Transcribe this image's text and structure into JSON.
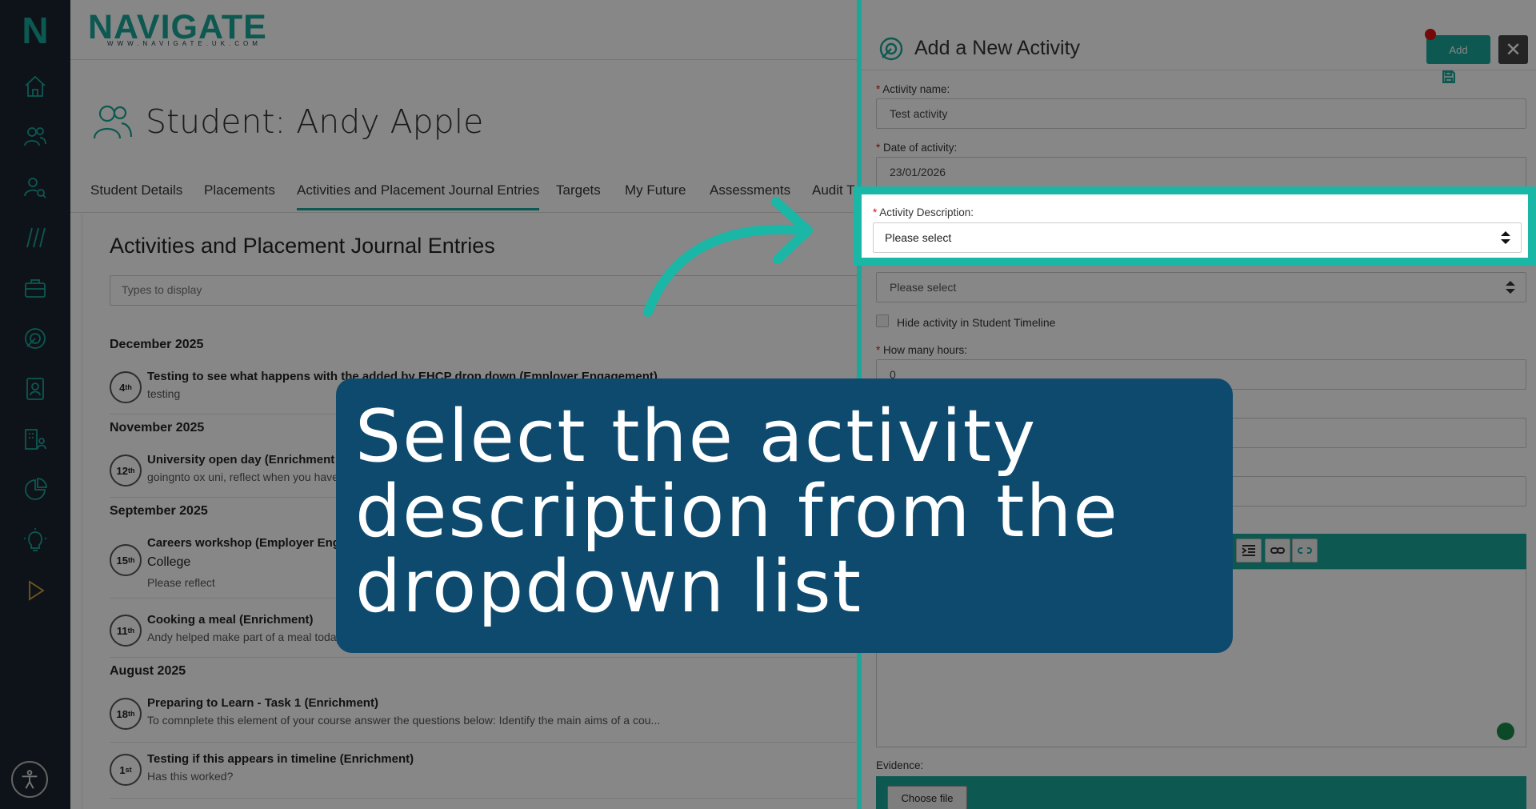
{
  "sidebar": {
    "logo": "N",
    "icons": [
      "home-icon",
      "users-icon",
      "user-search-icon",
      "slashes-icon",
      "briefcase-icon",
      "activity-icon",
      "contact-card-icon",
      "building-people-icon",
      "pie-chart-icon",
      "lightbulb-icon",
      "play-icon"
    ],
    "accessibility": "accessibility-icon"
  },
  "header": {
    "brand": "NAVIGATE",
    "brand_url": "WWW.NAVIGATE.UK.COM"
  },
  "student": {
    "title": "Student: Andy Apple"
  },
  "tabs": [
    "Student Details",
    "Placements",
    "Activities and Placement Journal Entries",
    "Targets",
    "My Future",
    "Assessments",
    "Audit T"
  ],
  "page": {
    "heading": "Activities and Placement Journal Entries",
    "filter_placeholder": "Types to display"
  },
  "timeline": {
    "months": [
      "December 2025",
      "November 2025",
      "September 2025",
      "August 2025"
    ],
    "entries": [
      {
        "day": "4",
        "suffix": "th",
        "title": "Testing to see what happens with the added by EHCP drop down (Employer Engagement)",
        "sub": "testing"
      },
      {
        "day": "12",
        "suffix": "th",
        "title": "University open day (Enrichment",
        "sub": "goingnto ox uni, reflect when you have"
      },
      {
        "day": "15",
        "suffix": "th",
        "title": "Careers workshop (Employer Eng",
        "extra": "College",
        "sub": "Please reflect"
      },
      {
        "day": "11",
        "suffix": "th",
        "title": "Cooking a meal (Enrichment)",
        "sub": "Andy helped make part of a meal today"
      },
      {
        "day": "18",
        "suffix": "th",
        "title": "Preparing to Learn - Task 1 (Enrichment)",
        "sub": "To comnplete this element of your course answer the questions below: Identify the main aims of a cou..."
      },
      {
        "day": "1",
        "suffix": "st",
        "title": "Testing if this appears in timeline (Enrichment)",
        "sub": "Has this worked?"
      }
    ]
  },
  "panel": {
    "title": "Add a New Activity",
    "add_label": "Add",
    "close_label": "✕",
    "fields": {
      "activity_name_label": "Activity name:",
      "activity_name_value": "Test activity",
      "date_label": "Date of activity:",
      "date_value": "23/01/2026",
      "description_label": "Activity Description:",
      "description_value": "Please select",
      "second_select_value": "Please select",
      "hide_label": "Hide activity in Student Timeline",
      "hours_label": "How many hours:",
      "hours_value": "0",
      "evidence_label": "Evidence:",
      "choose_file": "Choose file"
    }
  },
  "callout": {
    "text": "Select the activity description from the dropdown list"
  },
  "colors": {
    "accent": "#1aa79a",
    "sidebar": "#1b2430",
    "callout": "#0e4a6e",
    "highlight": "#1ab6a6",
    "required": "#d11111"
  }
}
